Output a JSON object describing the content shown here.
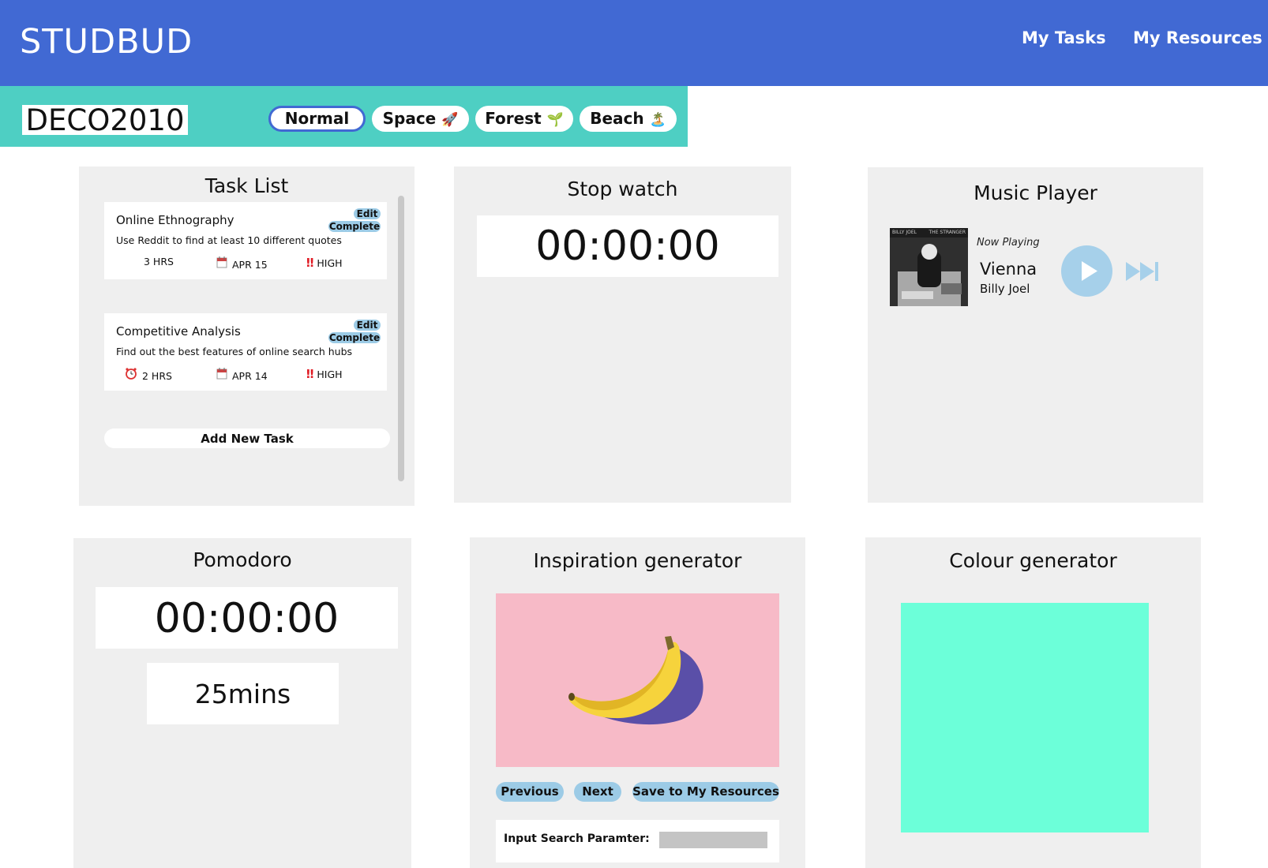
{
  "header": {
    "brand": "STUDBUD",
    "nav": [
      "My Tasks",
      "My Resources"
    ]
  },
  "subheader": {
    "course": "DECO2010",
    "themes": [
      {
        "label": "Normal",
        "emoji": "",
        "active": true
      },
      {
        "label": "Space",
        "emoji": "🚀",
        "active": false
      },
      {
        "label": "Forest",
        "emoji": "🌱",
        "active": false
      },
      {
        "label": "Beach",
        "emoji": "🏝️",
        "active": false
      }
    ]
  },
  "task_list": {
    "title": "Task List",
    "edit_label": "Edit",
    "complete_label": "Complete",
    "tasks": [
      {
        "name": "Online Ethnography",
        "description": "Use Reddit to find at least 10 different quotes",
        "hours": "3 HRS",
        "date": "APR 15",
        "priority": "HIGH"
      },
      {
        "name": "Competitive Analysis",
        "description": "Find out the best features of online search hubs",
        "hours": "2 HRS",
        "date": "APR 14",
        "priority": "HIGH"
      }
    ],
    "add_label": "Add New Task"
  },
  "stopwatch": {
    "title": "Stop watch",
    "time": "00:00:00"
  },
  "music": {
    "title": "Music Player",
    "album_text_left": "BILLY JOEL",
    "album_text_right": "THE STRANGER",
    "now_playing_label": "Now Playing",
    "song": "Vienna",
    "artist": "Billy Joel"
  },
  "pomodoro": {
    "title": "Pomodoro",
    "time": "00:00:00",
    "duration": "25mins"
  },
  "inspiration": {
    "title": "Inspiration generator",
    "previous_label": "Previous",
    "next_label": "Next",
    "save_label": "Save to My Resources",
    "search_label": "Input Search Paramter:",
    "search_value": ""
  },
  "colour": {
    "title": "Colour generator",
    "swatch": "#6cffd9"
  },
  "colors": {
    "header": "#4169d3",
    "subheader": "#4ecfc3",
    "panel": "#efefef",
    "pill": "#9ccbe6"
  }
}
